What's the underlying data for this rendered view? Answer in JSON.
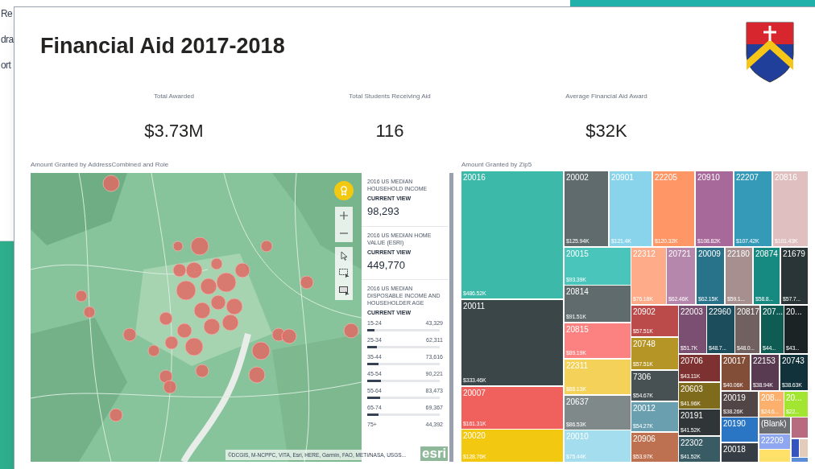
{
  "background_window": {
    "texts": [
      "Re",
      "dra",
      "ort"
    ]
  },
  "report": {
    "title": "Financial Aid 2017-2018",
    "kpis": [
      {
        "label": "Total Awarded",
        "value": "$3.73M"
      },
      {
        "label": "Total Students Receiving Aid",
        "value": "116"
      },
      {
        "label": "Average Financial Aid Award",
        "value": "$32K"
      }
    ],
    "map_visual": {
      "title": "Amount Granted by AddressCombined and Role",
      "attribution": "©DCGIS, M-NCPPC, VITA, Esri, HERE, Garmin, FAO, METI/NASA, USGS...",
      "logo_text": "esri",
      "infographic": [
        {
          "kind": "stat",
          "title": "2016 US MEDIAN HOUSEHOLD INCOME",
          "caption": "CURRENT VIEW",
          "value": "98,293"
        },
        {
          "kind": "stat",
          "title": "2016 US MEDIAN HOME VALUE (ESRI)",
          "caption": "CURRENT VIEW",
          "value": "449,770"
        },
        {
          "kind": "bars",
          "title": "2016 US MEDIAN DISPOSABLE INCOME AND HOUSEHOLDER AGE",
          "caption": "CURRENT VIEW",
          "rows": [
            {
              "label": "15-24",
              "value": "43,329",
              "level": 0.1
            },
            {
              "label": "25-34",
              "value": "62,311",
              "level": 0.13
            },
            {
              "label": "35-44",
              "value": "73,616",
              "level": 0.15
            },
            {
              "label": "45-54",
              "value": "90,221",
              "level": 0.19
            },
            {
              "label": "55-64",
              "value": "83,473",
              "level": 0.18
            },
            {
              "label": "65-74",
              "value": "69,367",
              "level": 0.15
            },
            {
              "label": "75+",
              "value": "44,392"
            }
          ]
        }
      ]
    },
    "treemap_visual": {
      "title": "Amount Granted by Zip5",
      "tiles": [
        {
          "zip": "20016",
          "amount": "$486.52K",
          "color": "#3cb9a8"
        },
        {
          "zip": "20011",
          "amount": "$333.46K",
          "color": "#3b4649"
        },
        {
          "zip": "20007",
          "amount": "$161.31K",
          "color": "#f0605c"
        },
        {
          "zip": "20020",
          "amount": "$128.76K",
          "color": "#f2c811"
        },
        {
          "zip": "20002",
          "amount": "$125.94K",
          "color": "#5f6b6d"
        },
        {
          "zip": "20901",
          "amount": "$121.4K",
          "color": "#8ad4eb"
        },
        {
          "zip": "22205",
          "amount": "$120.32K",
          "color": "#fe9666"
        },
        {
          "zip": "20910",
          "amount": "$108.82K",
          "color": "#a66999"
        },
        {
          "zip": "22207",
          "amount": "$107.42K",
          "color": "#3599b8"
        },
        {
          "zip": "20816",
          "amount": "$101.43K",
          "color": "#dfbfbf"
        },
        {
          "zip": "20015",
          "amount": "$93.39K",
          "color": "#4ac5bb"
        },
        {
          "zip": "20814",
          "amount": "$91.51K",
          "color": "#5f6b6d"
        },
        {
          "zip": "20815",
          "amount": "$89.19K",
          "color": "#fb8281"
        },
        {
          "zip": "22311",
          "amount": "$88.13K",
          "color": "#f4d25a"
        },
        {
          "zip": "20637",
          "amount": "$86.53K",
          "color": "#7f898a"
        },
        {
          "zip": "20010",
          "amount": "$75.44K",
          "color": "#a4ddee"
        },
        {
          "zip": "22312",
          "amount": "$76.18K",
          "color": "#fdab89"
        },
        {
          "zip": "20721",
          "amount": "$62.46K",
          "color": "#b687ac"
        },
        {
          "zip": "20009",
          "amount": "$62.15K",
          "color": "#28738a"
        },
        {
          "zip": "22180",
          "amount": "$59.1...",
          "color": "#a78f8f"
        },
        {
          "zip": "20874",
          "amount": "$58.8...",
          "color": "#168980"
        },
        {
          "zip": "21679",
          "amount": "$57.7...",
          "color": "#293537"
        },
        {
          "zip": "20902",
          "amount": "$57.51K",
          "color": "#bb4a4a"
        },
        {
          "zip": "20748",
          "amount": "$57.51K",
          "color": "#b59525"
        },
        {
          "zip": "7306",
          "amount": "$54.67K",
          "color": "#475052"
        },
        {
          "zip": "20012",
          "amount": "$54.27K",
          "color": "#6a9fb0"
        },
        {
          "zip": "20906",
          "amount": "$53.97K",
          "color": "#bd7150"
        },
        {
          "zip": "22003",
          "amount": "$51.7K",
          "color": "#7b4f71"
        },
        {
          "zip": "22960",
          "amount": "$48.7...",
          "color": "#1b4d5c"
        },
        {
          "zip": "20817",
          "amount": "$48.0...",
          "color": "#706060"
        },
        {
          "zip": "207...",
          "amount": "$44...",
          "color": "#0f5c55"
        },
        {
          "zip": "20...",
          "amount": "$43...",
          "color": "#1c2325"
        },
        {
          "zip": "20706",
          "amount": "$43.11K",
          "color": "#7d3231"
        },
        {
          "zip": "20603",
          "amount": "$41.96K",
          "color": "#7f6b1c"
        },
        {
          "zip": "20191",
          "amount": "$41.52K",
          "color": "#303637"
        },
        {
          "zip": "22302",
          "amount": "$41.52K",
          "color": "#395b64"
        },
        {
          "zip": "20017",
          "amount": "$40.06K",
          "color": "#834e38"
        },
        {
          "zip": "22153",
          "amount": "$38.94K",
          "color": "#583b51"
        },
        {
          "zip": "20743",
          "amount": "$38.63K",
          "color": "#12323b"
        },
        {
          "zip": "20019",
          "amount": "$38.26K",
          "color": "#524545"
        },
        {
          "zip": "208...",
          "amount": "$24.6...",
          "color": "#fbb06e"
        },
        {
          "zip": "20...",
          "amount": "$22...",
          "color": "#a3e632"
        },
        {
          "zip": "20190",
          "color": "#2a76c4"
        },
        {
          "zip": "20018",
          "color": "#373d45"
        },
        {
          "zip": "(Blank)",
          "color": "#6c6e72"
        },
        {
          "zip": "22209",
          "color": "#8fa7f0"
        },
        {
          "color": "#ffe169"
        },
        {
          "color": "#b86b80"
        },
        {
          "color": "#3455c0"
        },
        {
          "color": "#e3ccb9"
        },
        {
          "color": "#5b8dd6"
        }
      ]
    }
  }
}
